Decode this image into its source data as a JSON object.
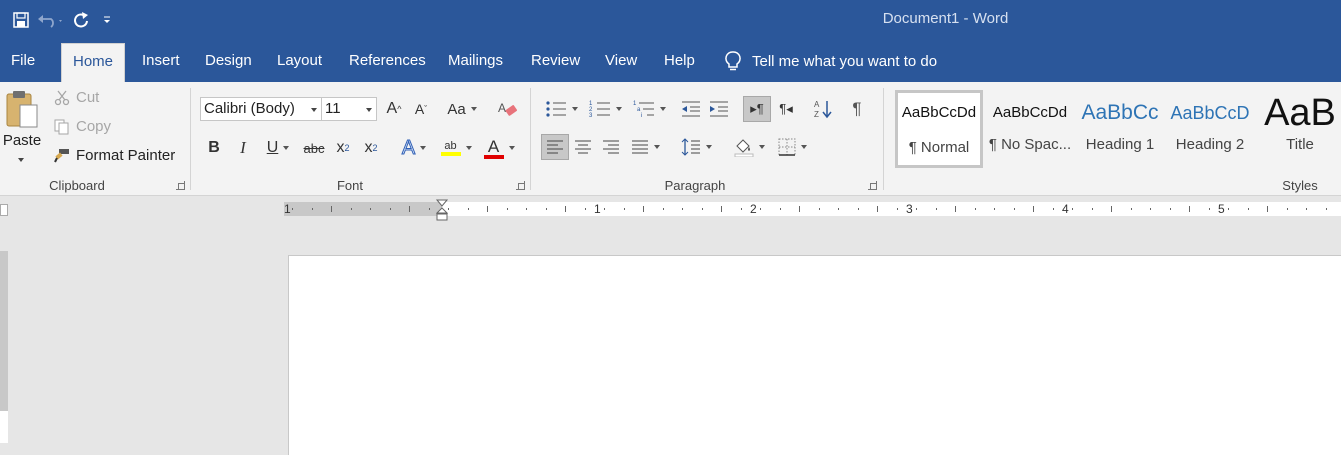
{
  "window": {
    "title": "Document1  -  Word"
  },
  "quick_access": {
    "save": "save-icon",
    "undo": "undo-icon",
    "redo": "redo-icon",
    "customize": "customize-icon"
  },
  "tabs": [
    {
      "label": "File"
    },
    {
      "label": "Home"
    },
    {
      "label": "Insert"
    },
    {
      "label": "Design"
    },
    {
      "label": "Layout"
    },
    {
      "label": "References"
    },
    {
      "label": "Mailings"
    },
    {
      "label": "Review"
    },
    {
      "label": "View"
    },
    {
      "label": "Help"
    }
  ],
  "tell_me": "Tell me what you want to do",
  "clipboard": {
    "paste": "Paste",
    "cut": "Cut",
    "copy": "Copy",
    "format_painter": "Format Painter",
    "label": "Clipboard"
  },
  "font": {
    "family": "Calibri (Body)",
    "size": "11",
    "label": "Font",
    "grow": "A",
    "shrink": "A",
    "case": "Aa",
    "bold": "B",
    "italic": "I",
    "underline": "U",
    "strike": "abc",
    "subscript": "x",
    "subscript_mark": "2",
    "superscript": "x",
    "superscript_mark": "2",
    "effects": "A",
    "highlight": "ab",
    "color": "A",
    "highlight_color": "#ffff00",
    "font_color": "#e00000"
  },
  "paragraph": {
    "label": "Paragraph",
    "pilcrow": "¶"
  },
  "styles": {
    "label": "Styles",
    "items": [
      {
        "sample": "AaBbCcDd",
        "name": "¶ Normal"
      },
      {
        "sample": "AaBbCcDd",
        "name": "¶ No Spac..."
      },
      {
        "sample": "AaBbCc",
        "name": "Heading 1"
      },
      {
        "sample": "AaBbCcD",
        "name": "Heading 2"
      },
      {
        "sample": "AaB",
        "name": "Title"
      }
    ]
  },
  "ruler": {
    "numbers": [
      "1",
      "1",
      "2",
      "3",
      "4",
      "5"
    ]
  },
  "colors": {
    "accent": "#2b579a",
    "ribbon": "#f3f3f3",
    "heading": "#2e74b5"
  }
}
